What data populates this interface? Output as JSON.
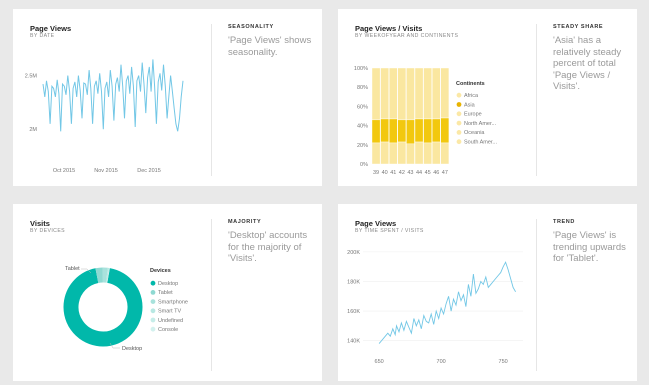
{
  "colors": {
    "line": "#72c7e6",
    "teal": "#01b8aa",
    "bar_dark": "#f2c80f",
    "bar_light": "#fae7a0",
    "background": "#e9e9e9"
  },
  "cards": [
    {
      "title": "Page Views",
      "subtitle": "BY DATE",
      "insight_heading": "SEASONALITY",
      "insight_text": "'Page Views' shows seasonality.",
      "chart_data": {
        "type": "line",
        "title": "Page Views",
        "subtitle": "BY DATE",
        "x_ticks": [
          "Oct 2015",
          "Nov 2015",
          "Dec 2015"
        ],
        "y_ticks": [
          "2M",
          "2.5M"
        ],
        "ylim": [
          1.75,
          2.7
        ],
        "series": [
          {
            "values": [
              2.42,
              2.3,
              2.45,
              2.35,
              2.05,
              2.4,
              2.38,
              2.3,
              2.46,
              2.33,
              1.98,
              2.42,
              2.4,
              2.32,
              2.5,
              2.35,
              2.05,
              2.38,
              2.44,
              2.3,
              2.5,
              2.36,
              2.1,
              2.43,
              2.42,
              2.32,
              2.55,
              2.38,
              2.05,
              2.4,
              2.45,
              2.33,
              2.52,
              2.35,
              2.0,
              2.38,
              2.44,
              2.3,
              2.55,
              2.4,
              2.08,
              2.42,
              2.48,
              2.35,
              2.6,
              2.4,
              2.1,
              2.45,
              2.5,
              2.33,
              2.58,
              2.4,
              2.02,
              2.45,
              2.5,
              2.35,
              2.62,
              2.42,
              2.15,
              2.48,
              2.58,
              2.35,
              2.65,
              2.4,
              2.05,
              2.44,
              2.52,
              2.36,
              2.6,
              2.4,
              2.1,
              2.3,
              2.5,
              2.35,
              2.2,
              2.05,
              1.98,
              2.1,
              2.3,
              2.45
            ]
          }
        ]
      }
    },
    {
      "title": "Page Views / Visits",
      "subtitle": "BY WEEKOFYEAR AND CONTINENTS",
      "insight_heading": "STEADY SHARE",
      "insight_text": "'Asia' has a relatively steady percent of total 'Page Views / Visits'.",
      "legend_title": "Continents",
      "chart_data": {
        "type": "bar",
        "stacked": "percent",
        "title": "Page Views / Visits",
        "subtitle": "BY WEEKOFYEAR AND CONTINENTS",
        "categories": [
          "39",
          "40",
          "41",
          "42",
          "43",
          "44",
          "45",
          "46",
          "47"
        ],
        "y_ticks": [
          "0%",
          "20%",
          "40%",
          "60%",
          "80%",
          "100%"
        ],
        "ylim": [
          0,
          100
        ],
        "series": [
          {
            "name": "Africa",
            "values": [
              22,
              23,
              22,
              23,
              21,
              23,
              22,
              23,
              22
            ]
          },
          {
            "name": "Asia",
            "values": [
              24,
              24,
              25,
              23,
              25,
              24,
              25,
              24,
              26
            ]
          },
          {
            "name": "Europe",
            "values": [
              54,
              53,
              53,
              54,
              54,
              53,
              53,
              53,
              52
            ]
          },
          {
            "name": "North Amer...",
            "values": [
              0,
              0,
              0,
              0,
              0,
              0,
              0,
              0,
              0
            ]
          },
          {
            "name": "Oceania",
            "values": [
              0,
              0,
              0,
              0,
              0,
              0,
              0,
              0,
              0
            ]
          },
          {
            "name": "South Amer...",
            "values": [
              0,
              0,
              0,
              0,
              0,
              0,
              0,
              0,
              0
            ]
          }
        ],
        "legend_colors": [
          "#fbe8a6",
          "#e8b300",
          "#fbe8a6",
          "#fbe8a6",
          "#fbe8a6",
          "#fbe8a6"
        ]
      }
    },
    {
      "title": "Visits",
      "subtitle": "BY DEVICES",
      "insight_heading": "MAJORITY",
      "insight_text": "'Desktop' accounts for the majority of 'Visits'.",
      "legend_title": "Devices",
      "callouts": {
        "top": "Tablet",
        "bottom": "Desktop"
      },
      "chart_data": {
        "type": "pie",
        "donut": true,
        "title": "Visits",
        "subtitle": "BY DEVICES",
        "categories": [
          "Desktop",
          "Tablet",
          "Smartphone",
          "Smart TV",
          "Undefined",
          "Console"
        ],
        "values": [
          94,
          3,
          2,
          0.5,
          0.3,
          0.2
        ],
        "legend_colors": [
          "#01b8aa",
          "#8fd9d2",
          "#a8e2dc",
          "#b8e8e3",
          "#c6ede9",
          "#d3f1ee"
        ]
      }
    },
    {
      "title": "Page Views",
      "subtitle": "BY TIME SPENT / VISITS",
      "insight_heading": "TREND",
      "insight_text": "'Page Views' is trending upwards for 'Tablet'.",
      "chart_data": {
        "type": "line",
        "title": "Page Views",
        "subtitle": "BY TIME SPENT / VISITS",
        "x_ticks": [
          "650",
          "700",
          "750"
        ],
        "y_ticks": [
          "140K",
          "160K",
          "180K",
          "200K"
        ],
        "xlim": [
          637,
          766
        ],
        "ylim": [
          133000,
          206000
        ],
        "series": [
          {
            "x": [
              650,
              653,
              655,
              657,
              659,
              661,
              663,
              664,
              666,
              668,
              670,
              672,
              674,
              676,
              678,
              680,
              682,
              684,
              686,
              688,
              690,
              692,
              694,
              696,
              698,
              700,
              702,
              704,
              706,
              708,
              710,
              712,
              714,
              716,
              718,
              720,
              722,
              724,
              726,
              728,
              730,
              732,
              734,
              736,
              738,
              740,
              742,
              744,
              746,
              748,
              750,
              752,
              754,
              756,
              758,
              760
            ],
            "values": [
              138000,
              141000,
              143000,
              145000,
              143000,
              148000,
              144000,
              150000,
              146000,
              152000,
              147000,
              153000,
              149000,
              145000,
              155000,
              150000,
              154000,
              148000,
              157000,
              153000,
              152000,
              158000,
              151000,
              160000,
              155000,
              162000,
              158000,
              165000,
              170000,
              160000,
              168000,
              164000,
              173000,
              167000,
              171000,
              163000,
              178000,
              170000,
              185000,
              172000,
              175000,
              180000,
              178000,
              183000,
              176000,
              178000,
              180000,
              182000,
              184000,
              186000,
              190000,
              193000,
              188000,
              182000,
              176000,
              173000
            ]
          }
        ]
      }
    }
  ]
}
